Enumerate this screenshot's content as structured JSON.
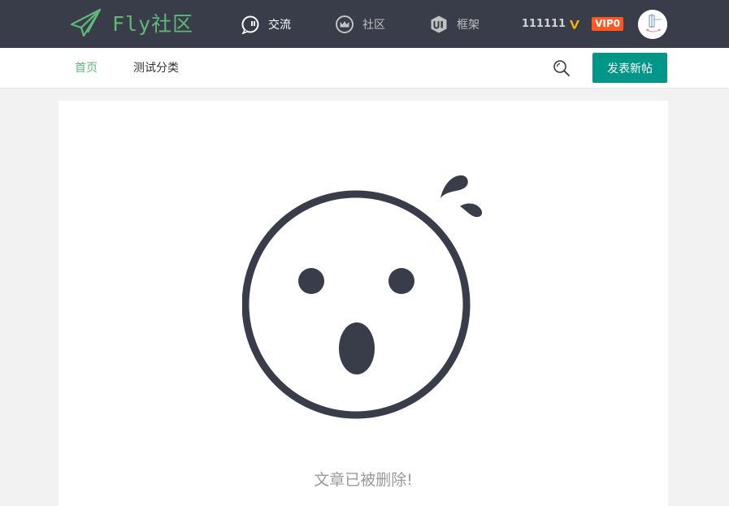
{
  "header": {
    "brand": "Fly社区",
    "nav": [
      {
        "label": "交流",
        "icon": "chat-bubble-icon",
        "active": true
      },
      {
        "label": "社区",
        "icon": "crown-icon",
        "active": false
      },
      {
        "label": "框架",
        "icon": "ui-shield-icon",
        "active": false
      }
    ],
    "user": {
      "name": "111111",
      "verified_icon": "verified-v-icon",
      "vip_label": "VIP0"
    }
  },
  "subnav": {
    "items": [
      {
        "label": "首页",
        "active": true
      },
      {
        "label": "测试分类",
        "active": false
      }
    ],
    "search_icon": "search-icon",
    "post_button": "发表新帖"
  },
  "content": {
    "illustration": "surprised-face-icon",
    "message": "文章已被删除!"
  },
  "colors": {
    "header_bg": "#393d49",
    "brand_green": "#5fb878",
    "primary_button": "#009688",
    "vip_badge": "#ff5722",
    "verified": "#ffb800"
  }
}
